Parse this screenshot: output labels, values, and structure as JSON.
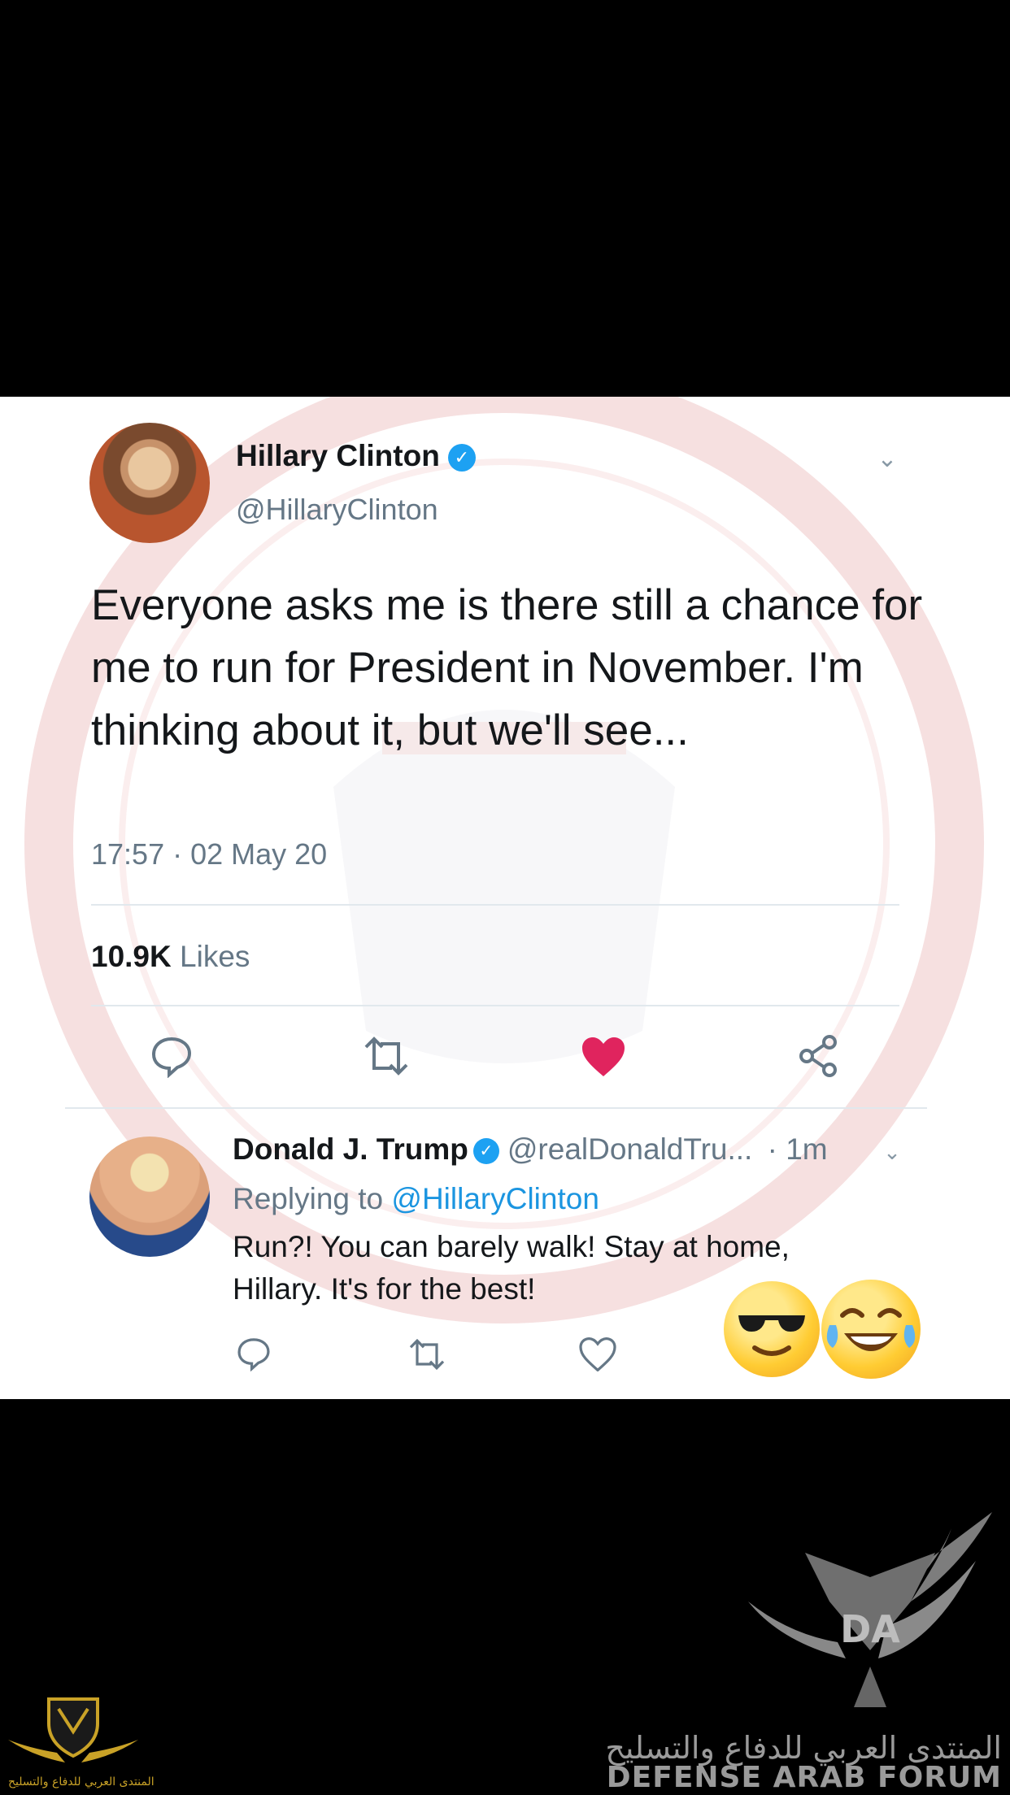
{
  "tweet": {
    "author_name": "Hillary Clinton",
    "author_handle": "@HillaryClinton",
    "text": "Everyone asks me is there still a chance for me to run for President in November. I'm thinking about it, but we'll see...",
    "timestamp": "17:57 · 02 May 20",
    "likes_count": "10.9K",
    "likes_label": "Likes",
    "liked": true
  },
  "reply": {
    "author_name": "Donald J. Trump",
    "author_handle": "@realDonaldTru...",
    "time": "· 1m",
    "replying_prefix": "Replying to",
    "replying_to": "@HillaryClinton",
    "text": "Run?! You can barely walk! Stay at home, Hillary. It's for the best!"
  },
  "watermark": {
    "arabic": "المنتدى العربي للدفاع والتسليح",
    "english": "DEFENSE ARAB FORUM",
    "small_text": "المنتدى العربي للدفاع والتسليح"
  },
  "colors": {
    "accent": "#1da1f2",
    "mention": "#1b95e0",
    "like": "#e0245e",
    "muted": "#657786"
  }
}
